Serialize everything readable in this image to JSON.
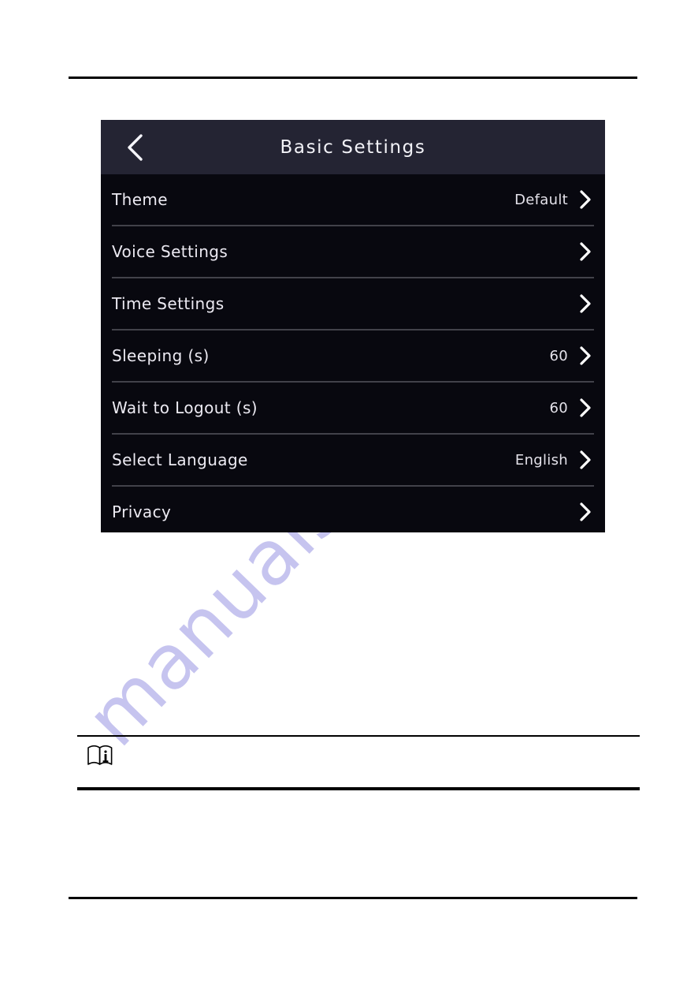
{
  "document": {
    "header_rule": true,
    "footer_rule": true,
    "watermark": "manualshive.com",
    "watermark_color": "#c2c0ee"
  },
  "device_screen": {
    "title": "Basic Settings",
    "back_icon": "chevron-left-icon",
    "header_color": "#242433",
    "body_color": "#08080f",
    "text_color": "#eceaf2",
    "rows": [
      {
        "label": "Theme",
        "value": "Default",
        "chevron": "chevron-right-icon"
      },
      {
        "label": "Voice Settings",
        "value": "",
        "chevron": "chevron-right-icon"
      },
      {
        "label": "Time Settings",
        "value": "",
        "chevron": "chevron-right-icon"
      },
      {
        "label": "Sleeping (s)",
        "value": "60",
        "chevron": "chevron-right-icon"
      },
      {
        "label": "Wait to Logout (s)",
        "value": "60",
        "chevron": "chevron-right-icon"
      },
      {
        "label": "Select Language",
        "value": "English",
        "chevron": "chevron-right-icon"
      },
      {
        "label": "Privacy",
        "value": "",
        "chevron": "chevron-right-icon"
      }
    ]
  },
  "note": {
    "icon": "manual-info-icon",
    "text": ""
  }
}
